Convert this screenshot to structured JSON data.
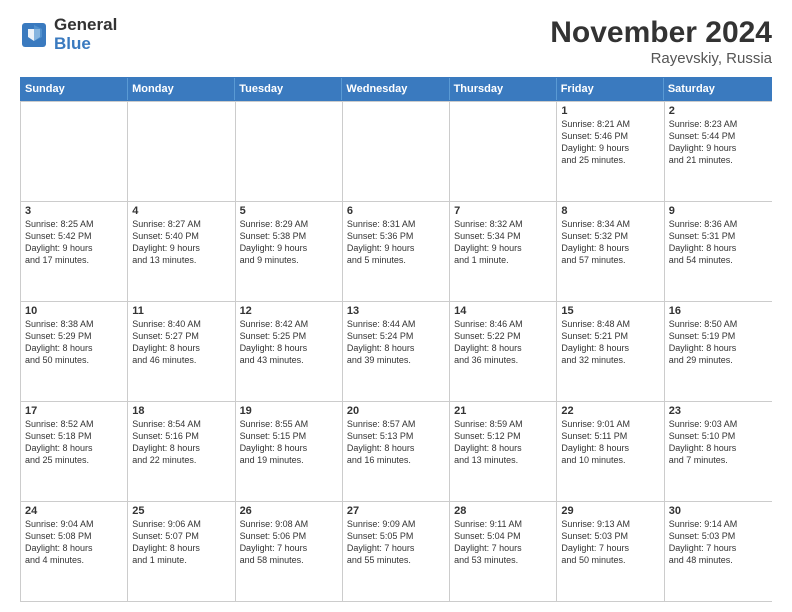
{
  "header": {
    "logo_general": "General",
    "logo_blue": "Blue",
    "month_title": "November 2024",
    "location": "Rayevskiy, Russia"
  },
  "calendar": {
    "weekdays": [
      "Sunday",
      "Monday",
      "Tuesday",
      "Wednesday",
      "Thursday",
      "Friday",
      "Saturday"
    ],
    "rows": [
      [
        {
          "day": "",
          "info": ""
        },
        {
          "day": "",
          "info": ""
        },
        {
          "day": "",
          "info": ""
        },
        {
          "day": "",
          "info": ""
        },
        {
          "day": "",
          "info": ""
        },
        {
          "day": "1",
          "info": "Sunrise: 8:21 AM\nSunset: 5:46 PM\nDaylight: 9 hours\nand 25 minutes."
        },
        {
          "day": "2",
          "info": "Sunrise: 8:23 AM\nSunset: 5:44 PM\nDaylight: 9 hours\nand 21 minutes."
        }
      ],
      [
        {
          "day": "3",
          "info": "Sunrise: 8:25 AM\nSunset: 5:42 PM\nDaylight: 9 hours\nand 17 minutes."
        },
        {
          "day": "4",
          "info": "Sunrise: 8:27 AM\nSunset: 5:40 PM\nDaylight: 9 hours\nand 13 minutes."
        },
        {
          "day": "5",
          "info": "Sunrise: 8:29 AM\nSunset: 5:38 PM\nDaylight: 9 hours\nand 9 minutes."
        },
        {
          "day": "6",
          "info": "Sunrise: 8:31 AM\nSunset: 5:36 PM\nDaylight: 9 hours\nand 5 minutes."
        },
        {
          "day": "7",
          "info": "Sunrise: 8:32 AM\nSunset: 5:34 PM\nDaylight: 9 hours\nand 1 minute."
        },
        {
          "day": "8",
          "info": "Sunrise: 8:34 AM\nSunset: 5:32 PM\nDaylight: 8 hours\nand 57 minutes."
        },
        {
          "day": "9",
          "info": "Sunrise: 8:36 AM\nSunset: 5:31 PM\nDaylight: 8 hours\nand 54 minutes."
        }
      ],
      [
        {
          "day": "10",
          "info": "Sunrise: 8:38 AM\nSunset: 5:29 PM\nDaylight: 8 hours\nand 50 minutes."
        },
        {
          "day": "11",
          "info": "Sunrise: 8:40 AM\nSunset: 5:27 PM\nDaylight: 8 hours\nand 46 minutes."
        },
        {
          "day": "12",
          "info": "Sunrise: 8:42 AM\nSunset: 5:25 PM\nDaylight: 8 hours\nand 43 minutes."
        },
        {
          "day": "13",
          "info": "Sunrise: 8:44 AM\nSunset: 5:24 PM\nDaylight: 8 hours\nand 39 minutes."
        },
        {
          "day": "14",
          "info": "Sunrise: 8:46 AM\nSunset: 5:22 PM\nDaylight: 8 hours\nand 36 minutes."
        },
        {
          "day": "15",
          "info": "Sunrise: 8:48 AM\nSunset: 5:21 PM\nDaylight: 8 hours\nand 32 minutes."
        },
        {
          "day": "16",
          "info": "Sunrise: 8:50 AM\nSunset: 5:19 PM\nDaylight: 8 hours\nand 29 minutes."
        }
      ],
      [
        {
          "day": "17",
          "info": "Sunrise: 8:52 AM\nSunset: 5:18 PM\nDaylight: 8 hours\nand 25 minutes."
        },
        {
          "day": "18",
          "info": "Sunrise: 8:54 AM\nSunset: 5:16 PM\nDaylight: 8 hours\nand 22 minutes."
        },
        {
          "day": "19",
          "info": "Sunrise: 8:55 AM\nSunset: 5:15 PM\nDaylight: 8 hours\nand 19 minutes."
        },
        {
          "day": "20",
          "info": "Sunrise: 8:57 AM\nSunset: 5:13 PM\nDaylight: 8 hours\nand 16 minutes."
        },
        {
          "day": "21",
          "info": "Sunrise: 8:59 AM\nSunset: 5:12 PM\nDaylight: 8 hours\nand 13 minutes."
        },
        {
          "day": "22",
          "info": "Sunrise: 9:01 AM\nSunset: 5:11 PM\nDaylight: 8 hours\nand 10 minutes."
        },
        {
          "day": "23",
          "info": "Sunrise: 9:03 AM\nSunset: 5:10 PM\nDaylight: 8 hours\nand 7 minutes."
        }
      ],
      [
        {
          "day": "24",
          "info": "Sunrise: 9:04 AM\nSunset: 5:08 PM\nDaylight: 8 hours\nand 4 minutes."
        },
        {
          "day": "25",
          "info": "Sunrise: 9:06 AM\nSunset: 5:07 PM\nDaylight: 8 hours\nand 1 minute."
        },
        {
          "day": "26",
          "info": "Sunrise: 9:08 AM\nSunset: 5:06 PM\nDaylight: 7 hours\nand 58 minutes."
        },
        {
          "day": "27",
          "info": "Sunrise: 9:09 AM\nSunset: 5:05 PM\nDaylight: 7 hours\nand 55 minutes."
        },
        {
          "day": "28",
          "info": "Sunrise: 9:11 AM\nSunset: 5:04 PM\nDaylight: 7 hours\nand 53 minutes."
        },
        {
          "day": "29",
          "info": "Sunrise: 9:13 AM\nSunset: 5:03 PM\nDaylight: 7 hours\nand 50 minutes."
        },
        {
          "day": "30",
          "info": "Sunrise: 9:14 AM\nSunset: 5:03 PM\nDaylight: 7 hours\nand 48 minutes."
        }
      ]
    ]
  }
}
